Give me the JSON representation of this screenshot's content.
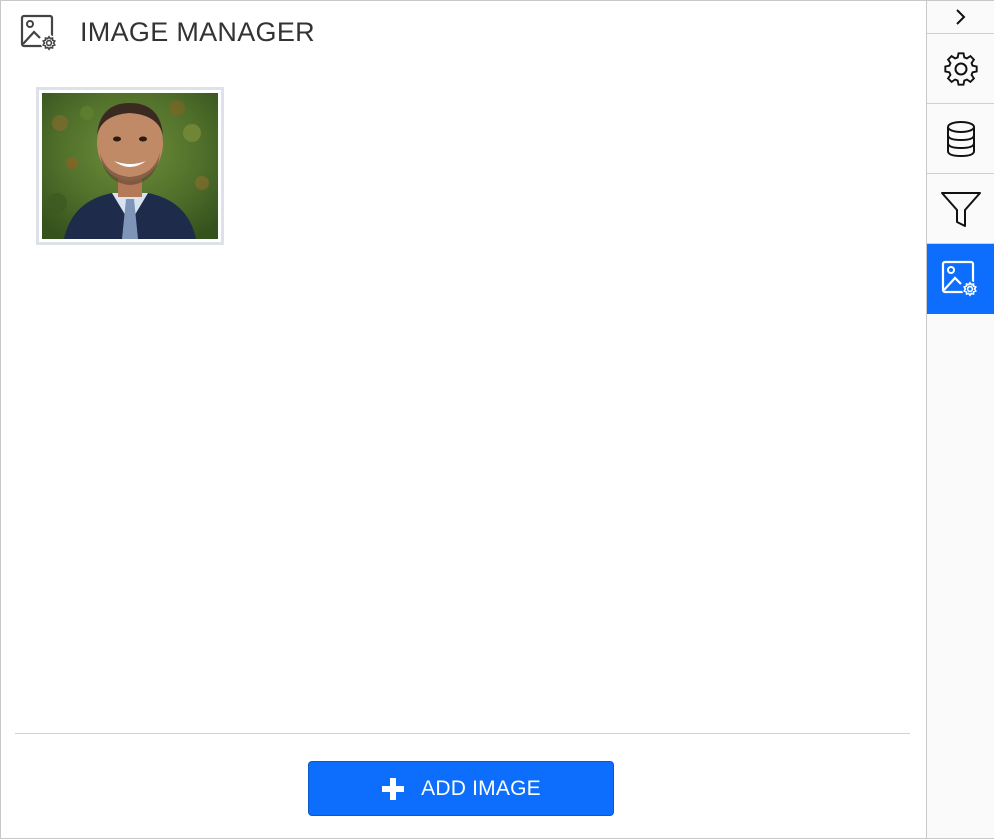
{
  "header": {
    "title": "IMAGE MANAGER",
    "icon": "image-settings-icon"
  },
  "images": [
    {
      "alt": "Portrait photo of smiling man in navy suit"
    }
  ],
  "footer": {
    "add_button_label": "ADD IMAGE",
    "add_icon": "plus-icon"
  },
  "rail": {
    "items": [
      {
        "name": "collapse",
        "icon": "chevron-right-icon"
      },
      {
        "name": "settings",
        "icon": "gear-icon"
      },
      {
        "name": "data",
        "icon": "database-icon"
      },
      {
        "name": "filter",
        "icon": "filter-icon"
      },
      {
        "name": "image-manager",
        "icon": "image-settings-icon",
        "active": true
      }
    ]
  },
  "colors": {
    "accent": "#0d6efd",
    "title_text": "#333333",
    "border": "#c8c8c8"
  }
}
